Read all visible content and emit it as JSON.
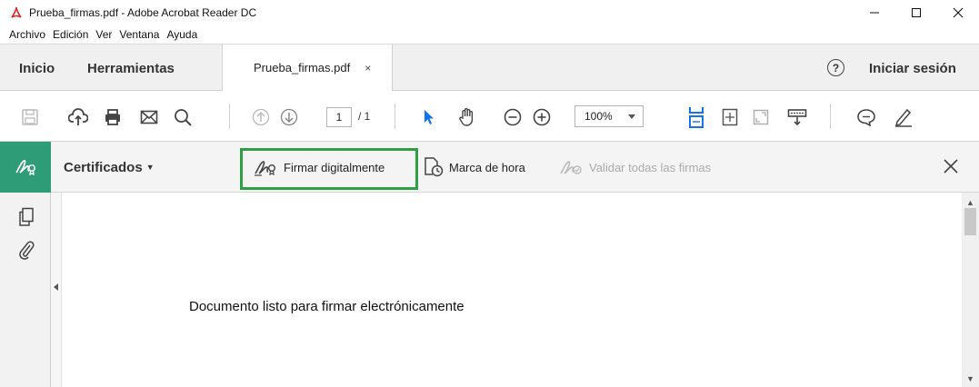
{
  "window": {
    "title": "Prueba_firmas.pdf - Adobe Acrobat Reader DC",
    "icon": "acrobat-pdf-icon",
    "controls": [
      "minimize",
      "maximize",
      "close"
    ]
  },
  "menubar": {
    "items": [
      "Archivo",
      "Edición",
      "Ver",
      "Ventana",
      "Ayuda"
    ]
  },
  "tabbar": {
    "home": "Inicio",
    "tools": "Herramientas",
    "document_tab": "Prueba_firmas.pdf",
    "document_tab_close": "×",
    "help": "?",
    "signin": "Iniciar sesión"
  },
  "toolbar": {
    "icons": [
      "save-icon",
      "upload-icon",
      "print-icon",
      "email-icon",
      "search-icon",
      "page-up-icon",
      "page-down-icon",
      "select-cursor-icon",
      "hand-tool-icon",
      "zoom-out-icon",
      "zoom-in-icon",
      "fit-width-icon",
      "fit-page-icon",
      "full-screen-icon",
      "read-mode-icon",
      "comment-icon",
      "highlight-pen-icon"
    ],
    "page_current": "1",
    "page_total": "/ 1",
    "zoom": "100%"
  },
  "certbar": {
    "title": "Certificados",
    "sign_digitally": "Firmar digitalmente",
    "timestamp": "Marca de hora",
    "validate_all": "Validar todas las firmas",
    "accent_color": "#2f9c78",
    "highlight_color": "#2ea043"
  },
  "leftrail": {
    "icons": [
      "page-thumbnails-icon",
      "attachments-icon"
    ]
  },
  "document": {
    "text": "Documento listo para firmar electrónicamente"
  }
}
